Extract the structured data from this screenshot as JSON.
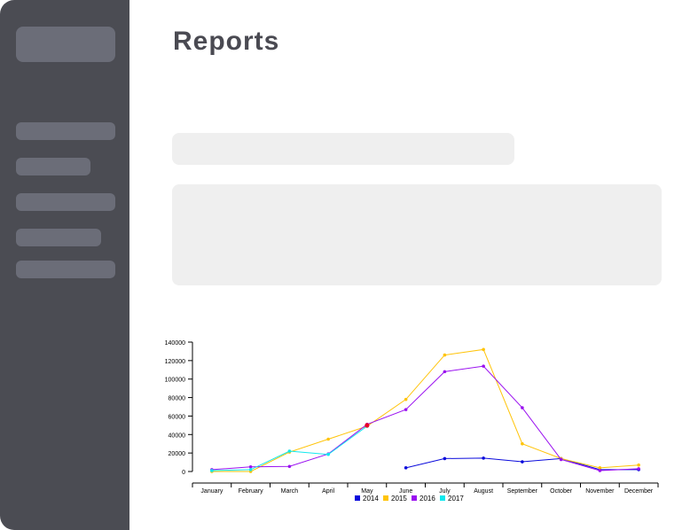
{
  "header": {
    "title": "Reports"
  },
  "colors": {
    "sidebar": "#4b4c53",
    "placeholder": "#efefef",
    "highlight": "#e8002a"
  },
  "chart_data": {
    "type": "line",
    "categories": [
      "January",
      "February",
      "March",
      "April",
      "May",
      "June",
      "July",
      "August",
      "September",
      "October",
      "November",
      "December"
    ],
    "ylim": [
      0,
      140000
    ],
    "yticks": [
      0,
      20000,
      40000,
      60000,
      80000,
      100000,
      120000,
      140000
    ],
    "grid": false,
    "legend_position": "bottom",
    "series": [
      {
        "name": "2014",
        "color": "#0a0adc",
        "values": [
          null,
          null,
          null,
          null,
          null,
          4000,
          14000,
          14500,
          10500,
          14000,
          2000,
          2000
        ]
      },
      {
        "name": "2015",
        "color": "#ffc40a",
        "values": [
          0,
          0,
          21000,
          35000,
          49000,
          78000,
          126000,
          132000,
          30000,
          14000,
          4000,
          7000
        ]
      },
      {
        "name": "2016",
        "color": "#9a10f0",
        "values": [
          2000,
          5000,
          5500,
          19000,
          51000,
          67000,
          108000,
          114000,
          69000,
          13000,
          1000,
          3000
        ]
      },
      {
        "name": "2017",
        "color": "#10e8ee",
        "values": [
          1000,
          2000,
          22000,
          18500,
          49000,
          null,
          null,
          null,
          null,
          null,
          null,
          null
        ]
      }
    ],
    "annotation": {
      "category": "May",
      "value": 50000,
      "color": "#e8002a"
    }
  }
}
